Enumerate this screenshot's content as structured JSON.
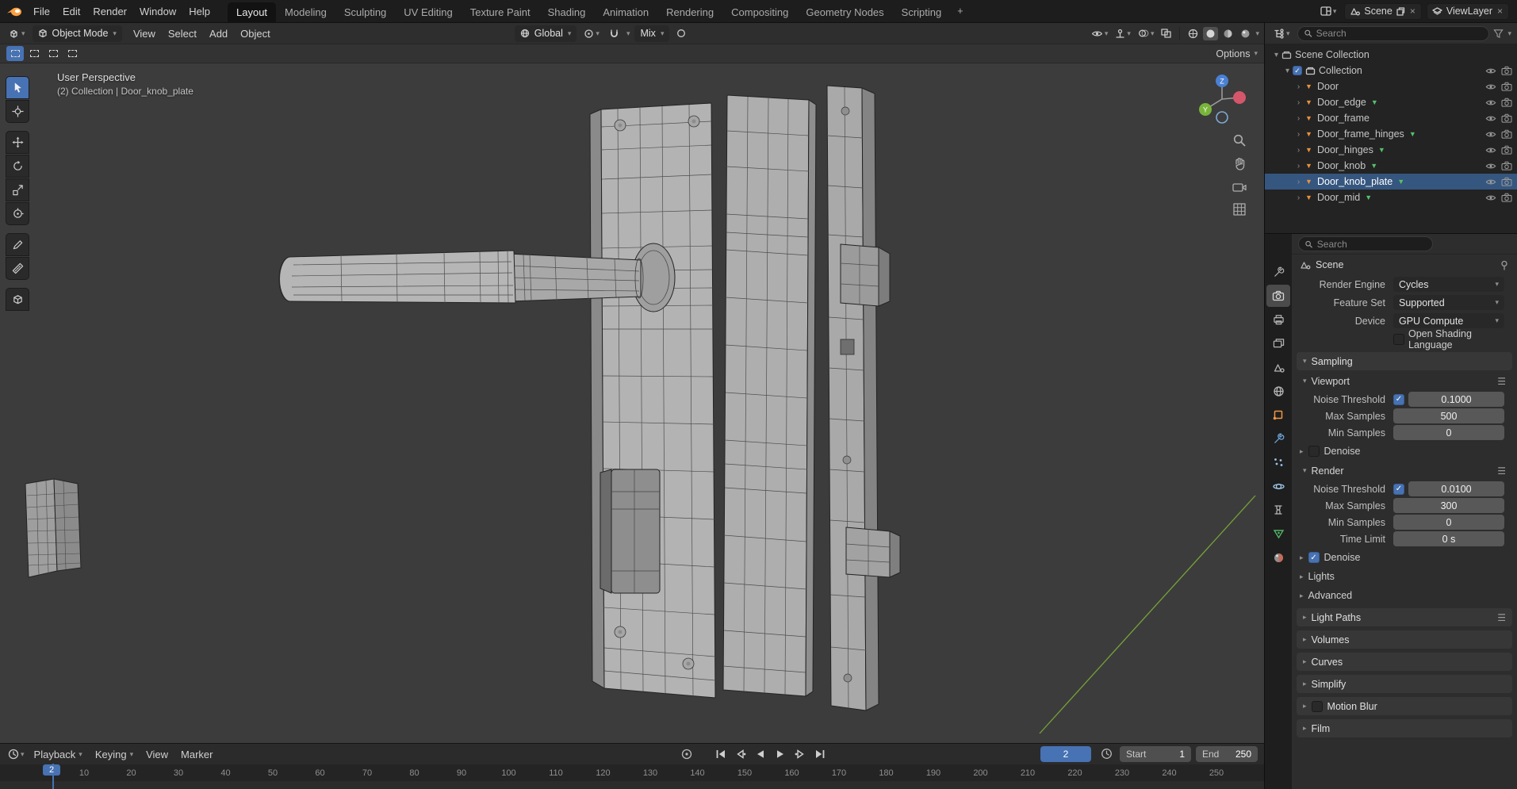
{
  "topbar": {
    "menus": [
      "File",
      "Edit",
      "Render",
      "Window",
      "Help"
    ],
    "tabs": [
      {
        "label": "Layout",
        "active": true
      },
      {
        "label": "Modeling"
      },
      {
        "label": "Sculpting"
      },
      {
        "label": "UV Editing"
      },
      {
        "label": "Texture Paint"
      },
      {
        "label": "Shading"
      },
      {
        "label": "Animation"
      },
      {
        "label": "Rendering"
      },
      {
        "label": "Compositing"
      },
      {
        "label": "Geometry Nodes"
      },
      {
        "label": "Scripting"
      }
    ],
    "add_tab": "+",
    "scene": "Scene",
    "viewlayer": "ViewLayer"
  },
  "viewport_header": {
    "mode": "Object Mode",
    "menus": [
      "View",
      "Select",
      "Add",
      "Object"
    ],
    "orientation": "Global",
    "falloff": "Mix"
  },
  "tool_settings": {
    "options": "Options"
  },
  "viewport": {
    "perspective": "User Perspective",
    "context": "(2) Collection | Door_knob_plate"
  },
  "outliner": {
    "search_placeholder": "Search",
    "scene_collection": "Scene Collection",
    "collection": "Collection",
    "items": [
      {
        "name": "Door",
        "data_icon": false,
        "selected": false
      },
      {
        "name": "Door_edge",
        "data_icon": true,
        "selected": false
      },
      {
        "name": "Door_frame",
        "data_icon": false,
        "selected": false
      },
      {
        "name": "Door_frame_hinges",
        "data_icon": true,
        "selected": false
      },
      {
        "name": "Door_hinges",
        "data_icon": true,
        "selected": false
      },
      {
        "name": "Door_knob",
        "data_icon": true,
        "selected": false
      },
      {
        "name": "Door_knob_plate",
        "data_icon": true,
        "selected": true
      },
      {
        "name": "Door_mid",
        "data_icon": true,
        "selected": false
      }
    ]
  },
  "properties": {
    "search_placeholder": "Search",
    "breadcrumb": "Scene",
    "render_engine": {
      "label": "Render Engine",
      "value": "Cycles"
    },
    "feature_set": {
      "label": "Feature Set",
      "value": "Supported"
    },
    "device": {
      "label": "Device",
      "value": "GPU Compute"
    },
    "osl_label": "Open Shading Language",
    "sampling_title": "Sampling",
    "viewport_sub": {
      "title": "Viewport",
      "noise_label": "Noise Threshold",
      "noise_value": "0.1000",
      "max_label": "Max Samples",
      "max_value": "500",
      "min_label": "Min Samples",
      "min_value": "0",
      "denoise_label": "Denoise"
    },
    "render_sub": {
      "title": "Render",
      "noise_label": "Noise Threshold",
      "noise_value": "0.0100",
      "max_label": "Max Samples",
      "max_value": "300",
      "min_label": "Min Samples",
      "min_value": "0",
      "time_label": "Time Limit",
      "time_value": "0 s",
      "denoise_label": "Denoise"
    },
    "lights_label": "Lights",
    "advanced_label": "Advanced",
    "collapsed": [
      {
        "label": "Light Paths",
        "menu": true
      },
      {
        "label": "Volumes"
      },
      {
        "label": "Curves"
      },
      {
        "label": "Simplify"
      },
      {
        "label": "Motion Blur",
        "checkbox": true
      },
      {
        "label": "Film"
      }
    ]
  },
  "timeline": {
    "menus": [
      {
        "label": "Playback",
        "dd": true
      },
      {
        "label": "Keying",
        "dd": true
      },
      {
        "label": "View"
      },
      {
        "label": "Marker"
      }
    ],
    "current_frame": "2",
    "start_label": "Start",
    "start_value": "1",
    "end_label": "End",
    "end_value": "250",
    "ruler": [
      10,
      20,
      30,
      40,
      50,
      60,
      70,
      80,
      90,
      100,
      110,
      120,
      130,
      140,
      150,
      160,
      170,
      180,
      190,
      200,
      210,
      220,
      230,
      240,
      250
    ]
  },
  "icons": {
    "search": "magnifier-icon",
    "filter": "funnel-icon",
    "visibility": "eye-icon",
    "render_visibility": "camera-icon",
    "section_menu": "hamburger-icon",
    "nav": [
      "zoom-icon",
      "hand-icon",
      "camera-view-icon",
      "ortho-grid-icon"
    ]
  }
}
